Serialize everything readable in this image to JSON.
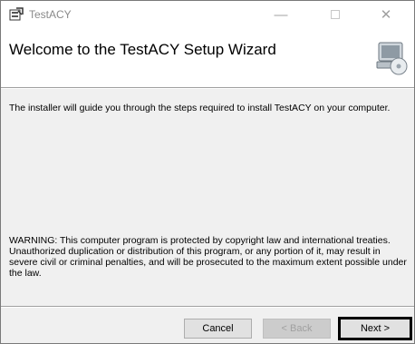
{
  "window": {
    "title": "TestACY",
    "icon": "installer-icon",
    "controls": {
      "minimize_glyph": "—",
      "close_glyph": "✕"
    }
  },
  "header": {
    "title": "Welcome to the TestACY Setup Wizard",
    "graphic": "computer-disc-icon"
  },
  "main": {
    "intro": "The installer will guide you through the steps required to install TestACY on your computer.",
    "warning": "WARNING: This computer program is protected by copyright law and international treaties. Unauthorized duplication or distribution of this program, or any portion of it, may result in severe civil or criminal penalties, and will be prosecuted to the maximum extent possible under the law."
  },
  "footer": {
    "cancel_label": "Cancel",
    "back_label": "< Back",
    "next_label": "Next >",
    "back_enabled": false
  }
}
